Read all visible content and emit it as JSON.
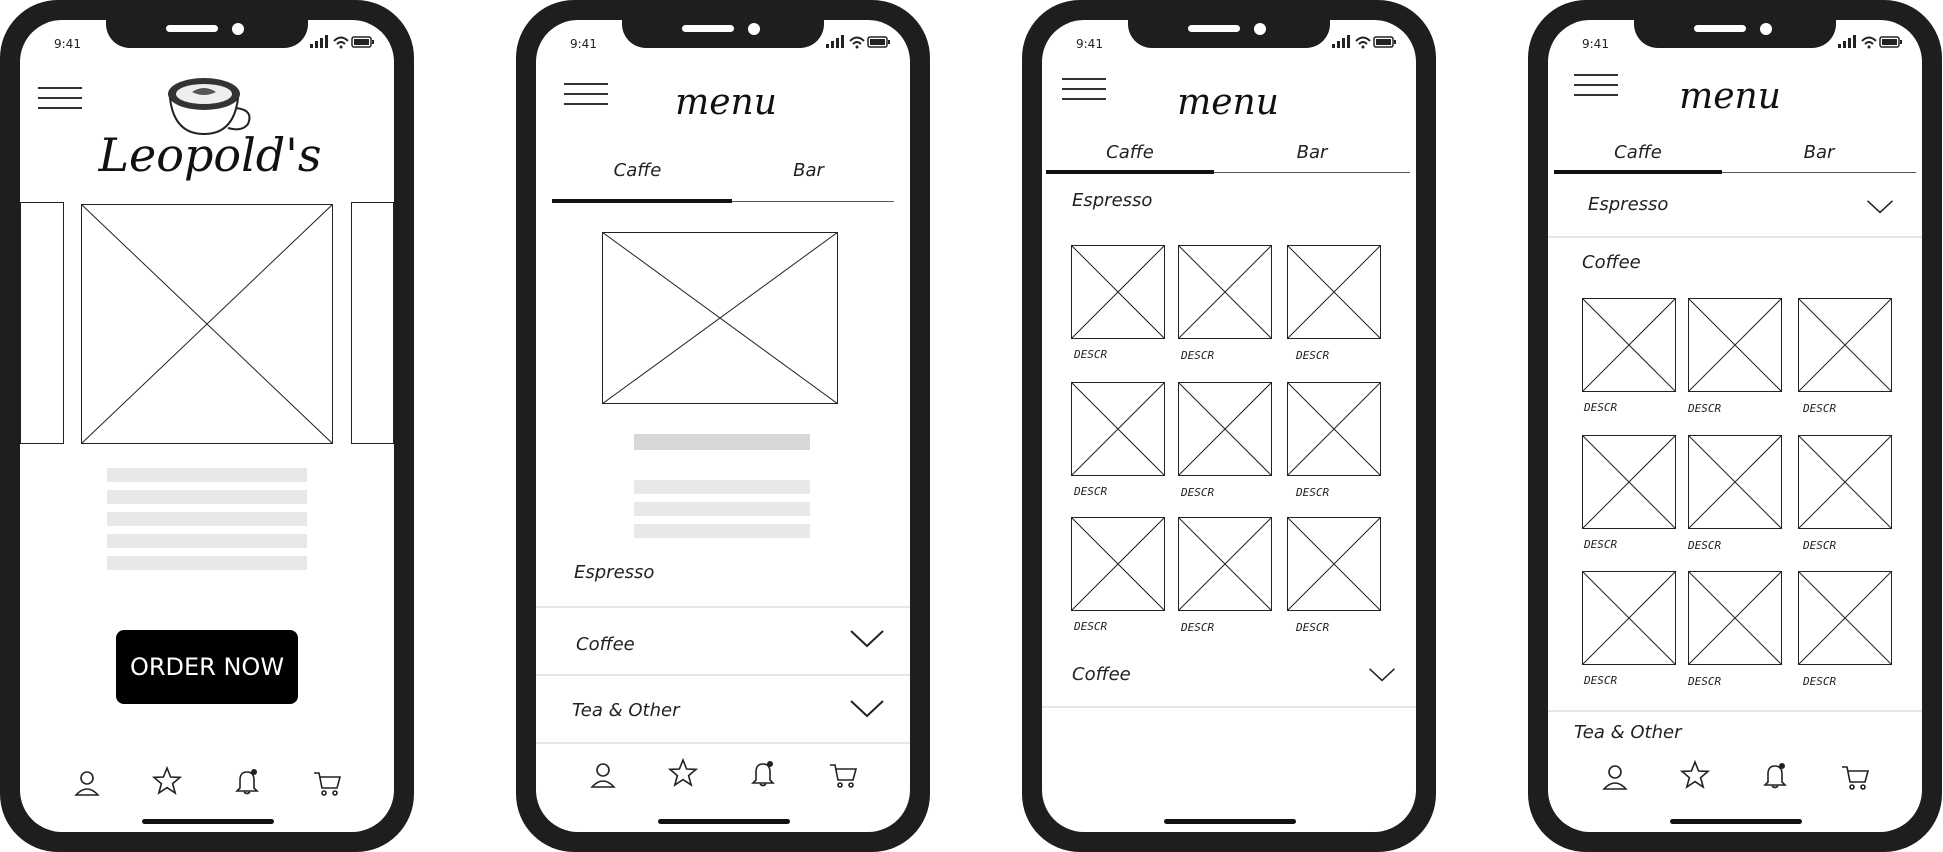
{
  "status": {
    "time": "9:41"
  },
  "screen1": {
    "brand": "Leopold's",
    "order_button": "ORDER NOW"
  },
  "screen2": {
    "title": "menu",
    "tabs": [
      "Caffe",
      "Bar"
    ],
    "sections": [
      "Espresso",
      "Coffee",
      "Tea & Other"
    ]
  },
  "screen3": {
    "title": "menu",
    "tabs": [
      "Caffe",
      "Bar"
    ],
    "section_open": "Espresso",
    "items": [
      "DESCR",
      "DESCR",
      "DESCR",
      "DESCR",
      "DESCR",
      "DESCR",
      "DESCR",
      "DESCR",
      "DESCR"
    ],
    "section_closed": "Coffee"
  },
  "screen4": {
    "title": "menu",
    "tabs": [
      "Caffe",
      "Bar"
    ],
    "section_collapsed": "Espresso",
    "section_open": "Coffee",
    "items": [
      "DESCR",
      "DESCR",
      "DESCR",
      "DESCR",
      "DESCR",
      "DESCR",
      "DESCR",
      "DESCR",
      "DESCR"
    ],
    "section_next": "Tea & Other"
  },
  "icons": {
    "nav": [
      "user-icon",
      "star-icon",
      "bell-icon",
      "cart-icon"
    ]
  }
}
